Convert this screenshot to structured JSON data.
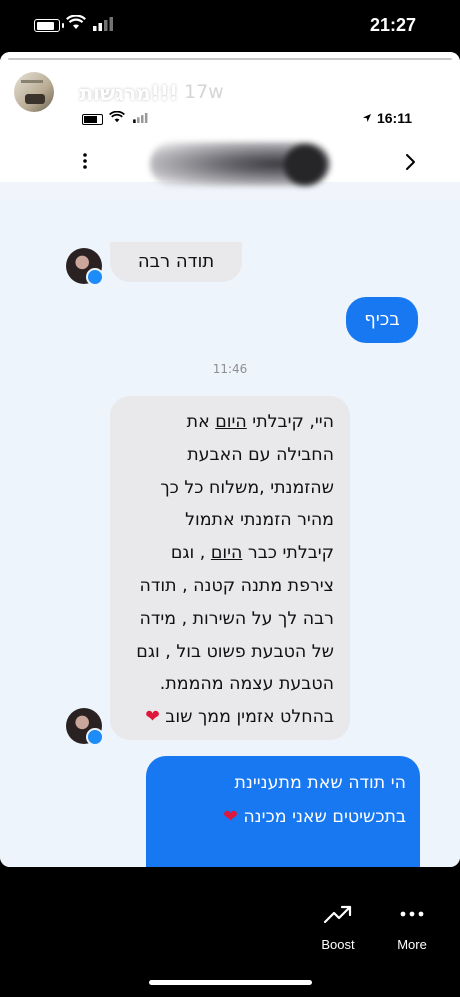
{
  "status_bar": {
    "time": "21:27"
  },
  "story": {
    "username": "!!!מרגשות",
    "posted_ago": "17w"
  },
  "inner_screenshot": {
    "status_time": "16:11",
    "messages": {
      "m1": "תודה רבה",
      "m2": "בכיף",
      "timestamp": "11:46",
      "m3_lines": [
        [
          "היי, קיבלתי ",
          "היום",
          " את"
        ],
        [
          "החבילה עם האבעת",
          "",
          ""
        ],
        [
          "שהזמנתי  ,משלוח כל כך",
          "",
          ""
        ],
        [
          "מהיר הזמנתי אתמול",
          "",
          ""
        ],
        [
          "קיבלתי כבר ",
          "היום",
          " , וגם"
        ],
        [
          "צירפת מתנה קטנה , תודה",
          "",
          ""
        ],
        [
          "רבה לך על השירות , מידה",
          "",
          ""
        ],
        [
          "של הטבעת פשוט בול , וגם",
          "",
          ""
        ],
        [
          "הטבעת עצמה מהממת.",
          "",
          ""
        ],
        [
          "בהחלט אזמין ממך שוב ",
          "",
          "❤"
        ]
      ],
      "m4_lines": [
        "הי תודה שאת מתעניינת",
        "בתכשיטים שאני מכינה ❤"
      ]
    }
  },
  "actions": {
    "boost_label": "Boost",
    "more_label": "More"
  }
}
